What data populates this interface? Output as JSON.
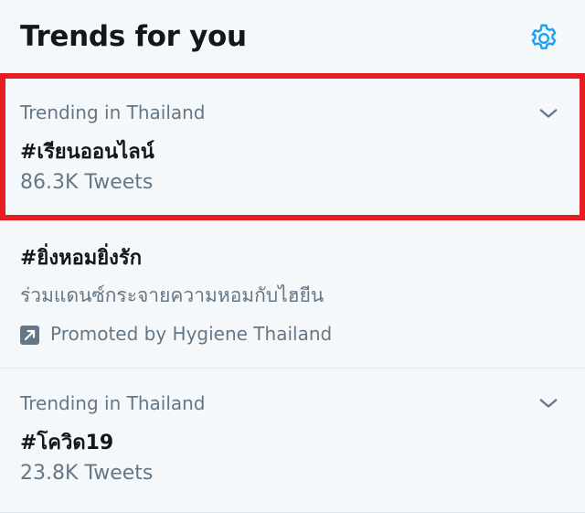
{
  "panel": {
    "title": "Trends for you",
    "settings_icon": "gear-icon"
  },
  "trends": [
    {
      "context": "Trending in Thailand",
      "name": "#เรียนออนไลน์",
      "count": "86.3K Tweets",
      "highlighted": true
    },
    {
      "name": "#ยิ่งหอมยิ่งรัก",
      "description": "ร่วมแดนซ์กระจายความหอมกับไฮยีน",
      "promoted": "Promoted by Hygiene Thailand"
    },
    {
      "context": "Trending in Thailand",
      "name": "#โควิด19",
      "count": "23.8K Tweets"
    }
  ],
  "colors": {
    "accent": "#1da1f2",
    "highlight": "#e81d24",
    "background": "#f5f8fa",
    "secondary_text": "#657786",
    "primary_text": "#14171a"
  }
}
